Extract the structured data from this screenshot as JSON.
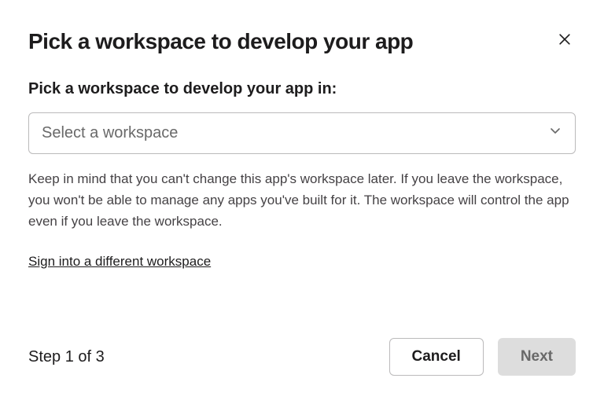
{
  "title": "Pick a workspace to develop your app",
  "field_label": "Pick a workspace to develop your app in:",
  "select_placeholder": "Select a workspace",
  "help_text": "Keep in mind that you can't change this app's workspace later. If you leave the workspace, you won't be able to manage any apps you've built for it. The workspace will control the app even if you leave the workspace.",
  "signin_link": "Sign into a different workspace",
  "step_text": "Step 1 of 3",
  "cancel_label": "Cancel",
  "next_label": "Next"
}
